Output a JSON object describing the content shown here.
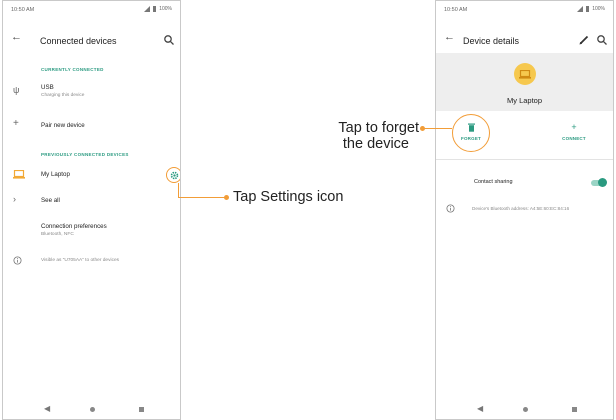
{
  "colors": {
    "accent": "#2a9a80",
    "callout": "#f29d38",
    "avatar": "#f6c84e",
    "header_bg": "#eeeeee"
  },
  "left_screen": {
    "status": {
      "time": "10:50 AM",
      "battery": "100%"
    },
    "appbar": {
      "title": "Connected devices",
      "back_icon": "back-arrow-icon",
      "search_icon": "search-icon"
    },
    "currently_connected_header": "CURRENTLY CONNECTED",
    "usb": {
      "title": "USB",
      "subtitle": "Charging this device",
      "icon": "usb-icon"
    },
    "pair": {
      "title": "Pair new device",
      "icon": "plus-icon"
    },
    "previously_connected_header": "PREVIOUSLY CONNECTED DEVICES",
    "laptop": {
      "title": "My Laptop",
      "icon": "laptop-icon",
      "settings_icon": "gear-icon"
    },
    "see_all": {
      "title": "See all",
      "icon": "chevron-right-icon"
    },
    "preferences": {
      "title": "Connection preferences",
      "subtitle": "Bluetooth, NFC"
    },
    "visible_info": {
      "text": "Visible as “U705AA” to other devices",
      "icon": "info-icon"
    }
  },
  "right_screen": {
    "status": {
      "time": "10:50 AM",
      "battery": "100%"
    },
    "appbar": {
      "title": "Device details",
      "back_icon": "back-arrow-icon",
      "edit_icon": "pencil-icon",
      "search_icon": "search-icon"
    },
    "device_name": "My Laptop",
    "actions": {
      "forget": "FORGET",
      "connect": "CONNECT"
    },
    "contact_sharing": {
      "label": "Contact sharing",
      "enabled": true
    },
    "bt_address": "Device's Bluetooth address: A4:5E:60:EC:84:16"
  },
  "callouts": {
    "settings": "Tap Settings icon",
    "forget_line1": "Tap to forget",
    "forget_line2": "the device"
  }
}
